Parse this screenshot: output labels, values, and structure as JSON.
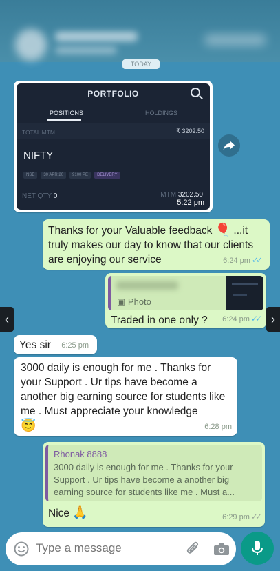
{
  "date_chip": "TODAY",
  "portfolio": {
    "header": "PORTFOLIO",
    "tab_positions": "POSITIONS",
    "tab_holdings": "HOLDINGS",
    "total_mtm_label": "TOTAL MTM",
    "total_mtm_value": "₹ 3202.50",
    "symbol": "NIFTY",
    "tags": [
      "NSE",
      "30 APR 20",
      "9100 PE",
      "DELIVERY"
    ],
    "net_qty_label": "NET QTY",
    "net_qty_value": "0",
    "mtm_label": "MTM",
    "mtm_value": "3202.50",
    "time": "5:22 pm"
  },
  "messages": [
    {
      "text": "Thanks for your Valuable feedback",
      "emoji": "🎈",
      "text2": " ...it truly makes our day to know that our clients are enjoying our service",
      "time": "6:24 pm"
    },
    {
      "quote_label": "Photo",
      "text": "Traded in one only ?",
      "time": "6:24 pm"
    },
    {
      "text": "Yes sir",
      "time": "6:25 pm"
    },
    {
      "text": "3000 daily is enough for me . Thanks for your Support . Ur tips have become a another big earning source for students like me . Must appreciate your knowledge",
      "emoji": "😇",
      "time": "6:28 pm"
    },
    {
      "quote_name": "Rhonak 8888",
      "quote_text": "3000 daily is enough for me . Thanks for your Support . Ur tips have become a another big earning source for students like me . Must a...",
      "text": "Nice",
      "emoji": "🙏",
      "time": "6:29 pm"
    }
  ],
  "input": {
    "placeholder": "Type a message"
  },
  "colors": {
    "chat_bg": "#3e8fb6",
    "outgoing": "#dcf8c6",
    "incoming": "#ffffff",
    "accent": "#0a9a88",
    "quote_bar": "#7e5ba1",
    "read_ticks": "#4fb6ec"
  },
  "icons": [
    "forward-icon",
    "emoji-icon",
    "attach-icon",
    "camera-icon",
    "mic-icon",
    "photo-icon"
  ]
}
